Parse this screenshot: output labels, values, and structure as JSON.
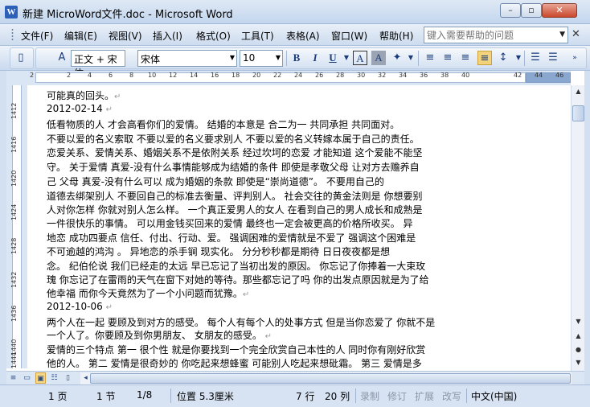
{
  "window": {
    "title": "新建 MicroWord文件.doc - Microsoft Word",
    "app_icon_letter": "W",
    "min_glyph": "–",
    "max_glyph": "▫",
    "close_glyph": "✕"
  },
  "menu": {
    "items": [
      "文件(F)",
      "编辑(E)",
      "视图(V)",
      "插入(I)",
      "格式(O)",
      "工具(T)",
      "表格(A)",
      "窗口(W)",
      "帮助(H)"
    ],
    "help_placeholder": "键入需要帮助的问题",
    "close_glyph": "✕"
  },
  "toolbar": {
    "style_value": "正文 + 宋体",
    "font_value": "宋体",
    "size_value": "10",
    "bold_label": "B",
    "italic_label": "I",
    "underline_label": "U",
    "char_border_label": "A",
    "char_shade_label": "A"
  },
  "ruler": {
    "ticks": [
      "2",
      "2",
      "4",
      "6",
      "8",
      "10",
      "12",
      "14",
      "16",
      "18",
      "20",
      "22",
      "24",
      "26",
      "28",
      "30",
      "32",
      "34",
      "36",
      "38",
      "40",
      "42",
      "44",
      "46"
    ],
    "vticks": [
      "1412",
      "1416",
      "1420",
      "1424",
      "1428",
      "1432",
      "1436",
      "1440",
      "1444"
    ]
  },
  "document": {
    "lines": [
      "可能真的回头。",
      "2012-02-14",
      "低看物质的人   才会高看你们的爱情。           结婚的本意是   合二为一   共同承担   共同面对。",
      "不要以爱的名义索取   不要以爱的名义要求别人   不要以爱的名义转嫁本属于自己的责任。",
      "恋爱关系、爱情关系、婚姻关系不是依附关系           经过坎坷的恋爱   才能知道   这个爱能不能坚",
      "守。        关于爱情   真爱-没有什么事情能够成为结婚的条件   即使是孝敬父母   让对方去赡养自",
      "己  父母      真爱-没有什么可以           成为婚姻的条款   即使是“崇尚道德”。           不要用自己的",
      "道德去绑架别人   不要回自己的标准去衡量、评判别人。          社会交往的黄金法则是   你想要别",
      "人对你怎样   你就对别人怎么样。         一个真正爱男人的女人   在看到自己的男人成长和成熟是",
      "一件很快乐的事情。          可以用金钱买回来的爱情   最终也一定会被更高的价格所收买。          异",
      "地恋   成功四要点   信任、付出、行动、爱。          强调困难的爱情就是不爱了   强调这个困难是",
      "不可逾越的鸿沟   。         异地恋的杀手锏   现实化。          分分秒秒都是期待   日日夜夜都是想",
      "念。        纪伯伦说   我们已经走的太远   早已忘记了当初出发的原因。   你忘记了你捧着一大束玫",
      "瑰   你忘记了在雷雨的天气在窗下对她的等待。那些都忘记了吗      你的出发点原因就是为了给",
      "他幸福   而你今天竟然为了一个小问题而犹豫。",
      "2012-10-06",
      "两个人在一起   要顾及到对方的感受。   每个人有每个人的处事方式   但是当你恋爱了   你就不是",
      "一个人了。你要顾及到你男朋友、  女朋友的感受。",
      "爱情的三个特点      第一   很个性   就是你要找到一个完全欣赏自己本性的人   同时你有刚好欣赏",
      "他的人。    第二   爱情是很奇妙的   你吃起来想蜂蜜   可能别人吃起来想砒霜。   第三   爱情是多"
    ],
    "para_mark": "↵"
  },
  "status": {
    "page": "1 页",
    "section": "1 节",
    "page_of": "1/8",
    "position": "位置 5.3厘米",
    "line": "7 行",
    "column": "20 列",
    "rec": "录制",
    "trk": "修订",
    "ext": "扩展",
    "ovr": "改写",
    "language": "中文(中国)"
  },
  "colors": {
    "accent": "#2b5fb8",
    "chrome": "#dbe6f4"
  }
}
